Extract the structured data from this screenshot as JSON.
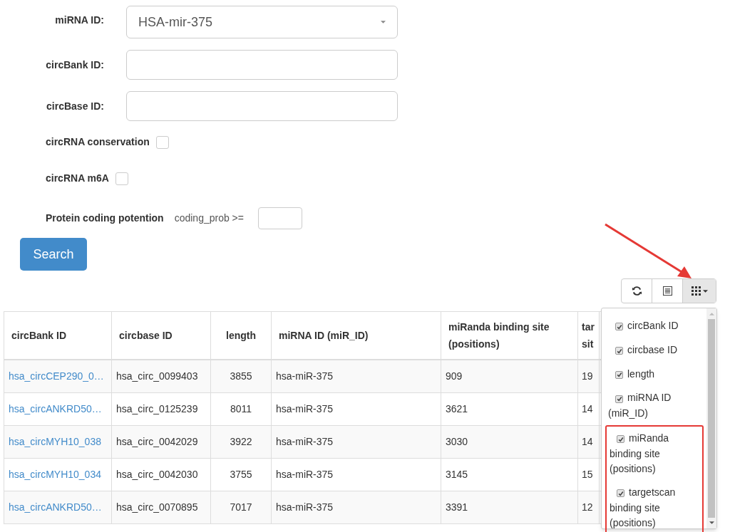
{
  "form": {
    "mirna": {
      "label": "miRNA ID:",
      "value": "HSA-mir-375"
    },
    "circbank": {
      "label": "circBank ID:"
    },
    "circbase": {
      "label": "circBase ID:"
    },
    "checks": [
      {
        "label": "circRNA conservation",
        "checked": false
      },
      {
        "label": "circRNA m6A",
        "checked": false
      }
    ],
    "coding": {
      "label": "Protein coding potention",
      "hint": "coding_prob >="
    },
    "search": "Search"
  },
  "table": {
    "columns": [
      "circBank ID",
      "circbase ID",
      "length",
      "miRNA ID (miR_ID)",
      "miRanda binding site (positions)",
      "tar\nsit"
    ],
    "rows": [
      [
        "hsa_circCEP290_0…",
        "hsa_circ_0099403",
        "3855",
        "hsa-miR-375",
        "909",
        "19"
      ],
      [
        "hsa_circANKRD50…",
        "hsa_circ_0125239",
        "8011",
        "hsa-miR-375",
        "3621",
        "14"
      ],
      [
        "hsa_circMYH10_038",
        "hsa_circ_0042029",
        "3922",
        "hsa-miR-375",
        "3030",
        "14"
      ],
      [
        "hsa_circMYH10_034",
        "hsa_circ_0042030",
        "3755",
        "hsa-miR-375",
        "3145",
        "15"
      ],
      [
        "hsa_circANKRD50…",
        "hsa_circ_0070895",
        "7017",
        "hsa-miR-375",
        "3391",
        "12"
      ]
    ]
  },
  "columns_menu": {
    "open": true,
    "items": [
      {
        "label": "circBank ID",
        "checked": true,
        "highlighted": false
      },
      {
        "label": "circbase ID",
        "checked": true,
        "highlighted": false
      },
      {
        "label": "length",
        "checked": true,
        "highlighted": false
      },
      {
        "label": "miRNA ID (miR_ID)",
        "checked": true,
        "highlighted": false
      },
      {
        "label": "miRanda binding site (positions)",
        "checked": true,
        "highlighted": true
      },
      {
        "label": "targetscan binding site (positions)",
        "checked": true,
        "highlighted": true
      }
    ]
  }
}
